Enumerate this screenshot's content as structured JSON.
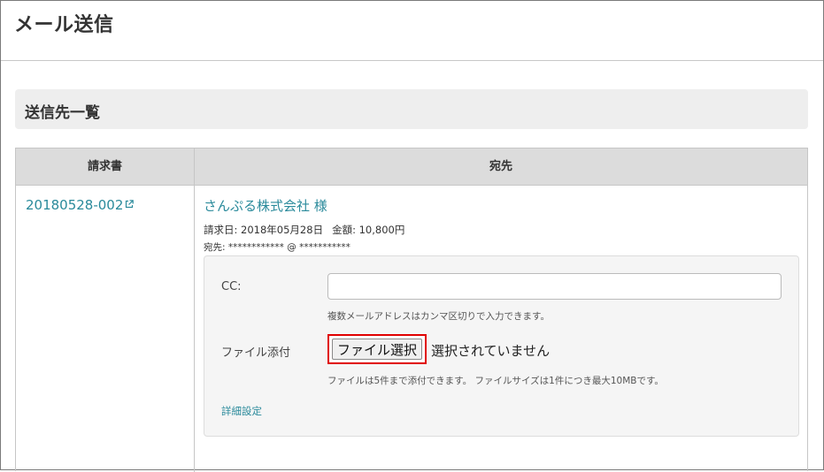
{
  "page": {
    "title": "メール送信"
  },
  "section": {
    "title": "送信先一覧"
  },
  "table": {
    "headers": {
      "invoice": "請求書",
      "recipient": "宛先"
    },
    "row": {
      "invoice_number": "20180528-002",
      "company": "さんぷる株式会社 様",
      "invoice_date_label": "請求日:",
      "invoice_date": "2018年05月28日",
      "amount_label": "金額:",
      "amount": "10,800円",
      "to_label": "宛先:",
      "to_value": "************ @ ***********"
    }
  },
  "form": {
    "cc_label": "CC:",
    "cc_value": "",
    "cc_help": "複数メールアドレスはカンマ区切りで入力できます。",
    "attach_label": "ファイル添付",
    "file_button_label": "ファイル選択",
    "file_status": "選択されていません",
    "attach_help": "ファイルは5件まで添付できます。 ファイルサイズは1件につき最大10MBです。",
    "details_link": "詳細設定"
  },
  "icons": {
    "external_link": "external-link-icon"
  },
  "colors": {
    "link": "#2a8a9b",
    "highlight": "#e00000",
    "header_bg": "#dcdcdc",
    "section_bg": "#eeeeee"
  }
}
